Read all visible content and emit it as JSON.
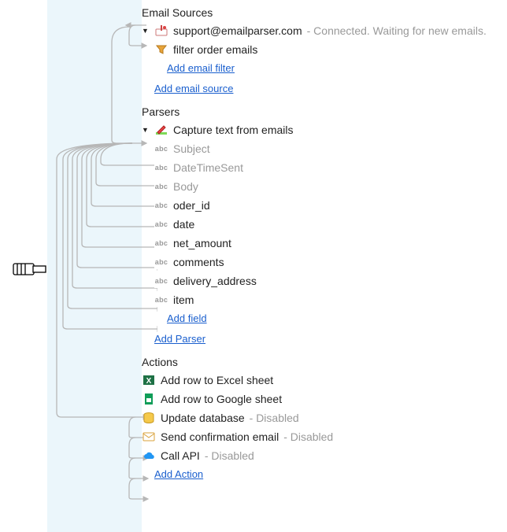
{
  "sections": {
    "email_sources": {
      "title": "Email Sources",
      "source": {
        "label": "support@emailparser.com",
        "status": "- Connected. Waiting for new emails."
      },
      "filter": {
        "label": "filter order emails"
      },
      "add_filter": "Add email filter",
      "add_source": "Add email source"
    },
    "parsers": {
      "title": "Parsers",
      "parser": {
        "label": "Capture text from emails"
      },
      "fields": [
        {
          "label": "Subject",
          "dim": true
        },
        {
          "label": "DateTimeSent",
          "dim": true
        },
        {
          "label": "Body",
          "dim": true
        },
        {
          "label": "oder_id",
          "dim": false
        },
        {
          "label": "date",
          "dim": false
        },
        {
          "label": "net_amount",
          "dim": false
        },
        {
          "label": "comments",
          "dim": false
        },
        {
          "label": "delivery_address",
          "dim": false
        },
        {
          "label": "item",
          "dim": false
        }
      ],
      "add_field": "Add field",
      "add_parser": "Add Parser"
    },
    "actions": {
      "title": "Actions",
      "items": [
        {
          "label": "Add row to Excel sheet",
          "status": ""
        },
        {
          "label": "Add row to Google sheet",
          "status": ""
        },
        {
          "label": "Update database",
          "status": "- Disabled"
        },
        {
          "label": "Send confirmation email",
          "status": "- Disabled"
        },
        {
          "label": "Call API",
          "status": "- Disabled"
        }
      ],
      "add_action": "Add Action"
    }
  },
  "badges": {
    "abc": "abc"
  }
}
